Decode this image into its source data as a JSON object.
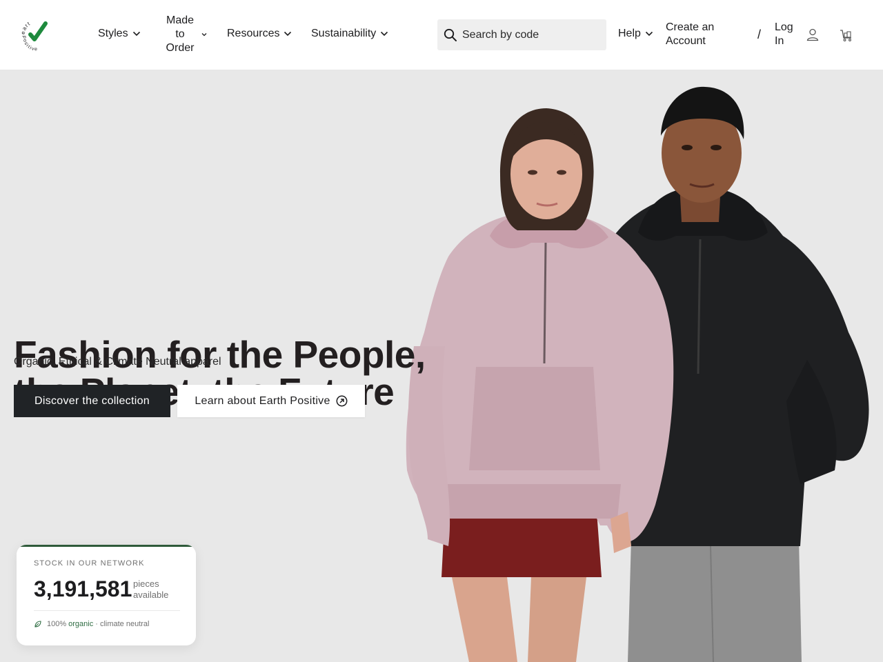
{
  "brand": {
    "logo_text_top": "eart",
    "logo_text_bottom": "positive",
    "accent_color": "#1e8a3d"
  },
  "nav": {
    "items": [
      {
        "label": "Styles",
        "icon": "chevron-down-icon"
      },
      {
        "label_lines": [
          "Made",
          "to",
          "Order"
        ],
        "icon": "chevron-down-icon"
      },
      {
        "label": "Resources",
        "icon": "chevron-down-icon"
      },
      {
        "label": "Sustainability",
        "icon": "chevron-down-icon"
      },
      {
        "label": "Help",
        "icon": "chevron-down-icon"
      }
    ]
  },
  "search": {
    "placeholder": "Search by code",
    "icon": "search-icon"
  },
  "account": {
    "create_lines": [
      "Create an",
      "Account"
    ],
    "separator": "/",
    "login_lines": [
      "Log",
      "In"
    ],
    "user_icon": "user-icon",
    "cart_icon": "cart-icon"
  },
  "hero": {
    "headline_lines": [
      "Fashion for the People,",
      "the Planet, the Future"
    ],
    "subline": "Organic, Ethical & Climate Neutral apparel",
    "primary_cta": "Discover the collection",
    "secondary_cta": "Learn about Earth Positive",
    "secondary_icon": "arrow-up-right-circle-icon",
    "background_color": "#e8e8e8",
    "cta_dark_color": "#202326"
  },
  "stock": {
    "label": "STOCK IN OUR NETWORK",
    "value": "3,191,581",
    "unit_lines": [
      "pieces",
      "available"
    ],
    "foot_prefix": "100%",
    "foot_highlight": "organic",
    "foot_suffix": "· climate neutral",
    "leaf_icon": "leaf-icon",
    "accent_color": "#2f5a3a"
  }
}
